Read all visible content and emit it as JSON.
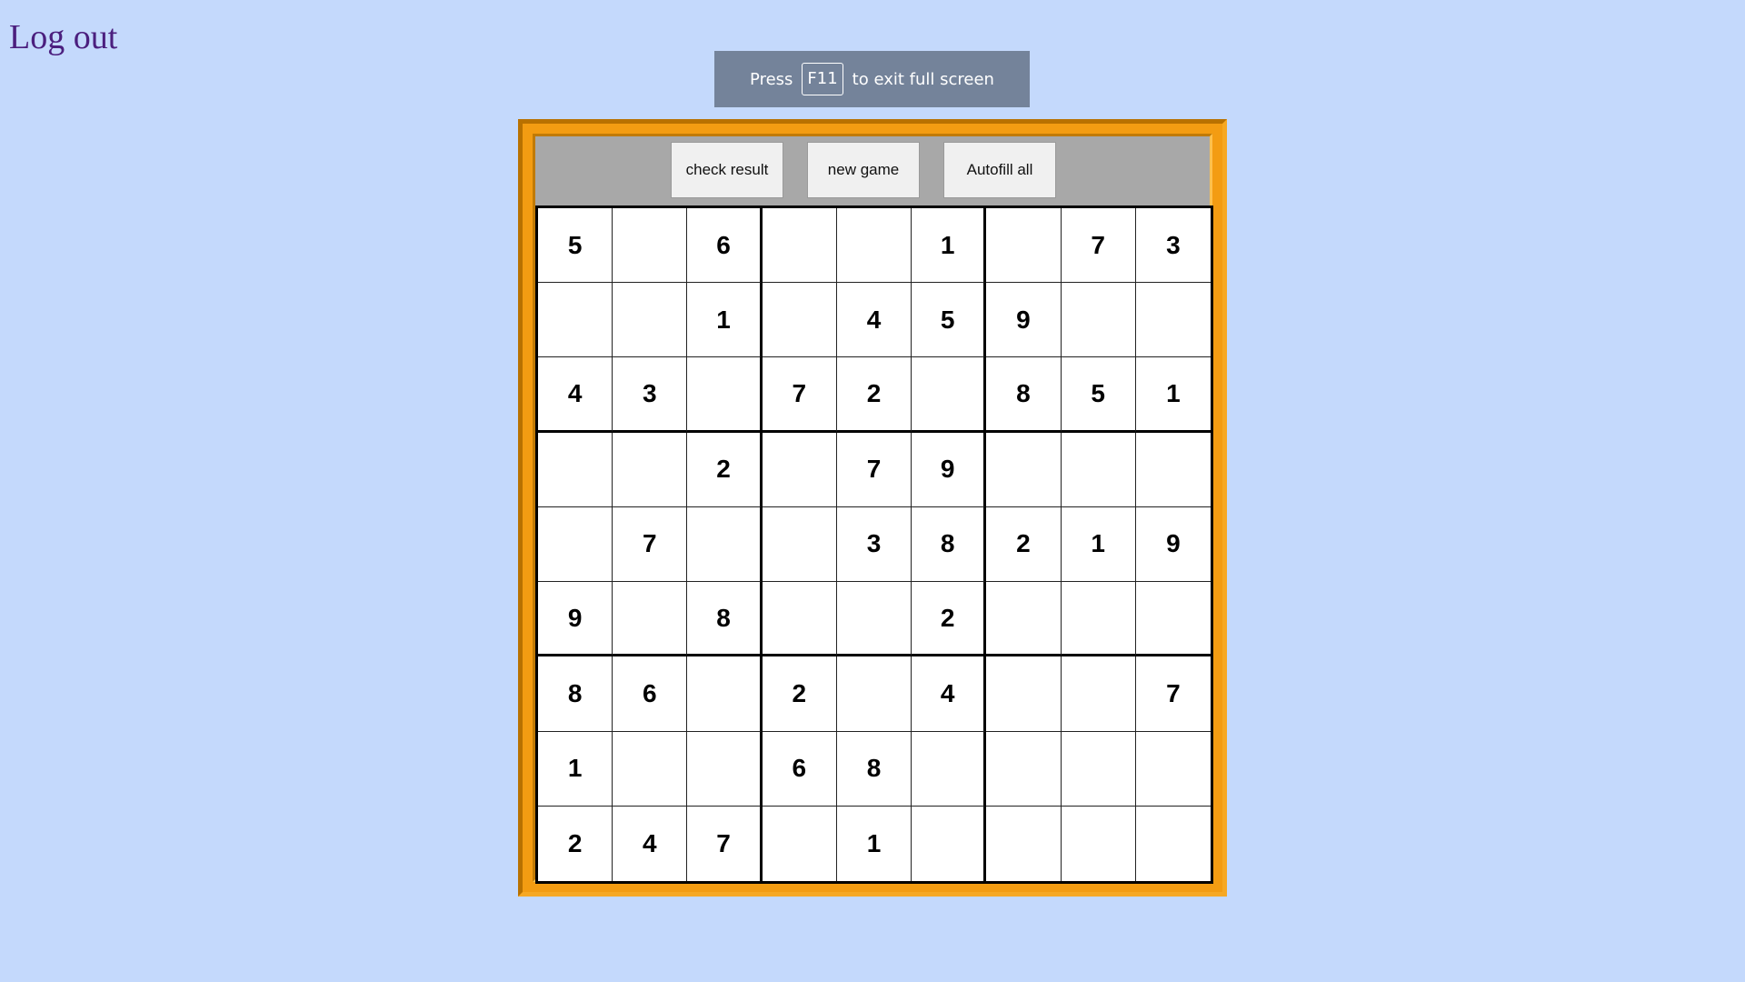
{
  "header": {
    "logout_label": "Log out"
  },
  "fullscreen_notice": {
    "before": "Press",
    "key": "F11",
    "after": "to exit full screen"
  },
  "toolbar": {
    "check_label": "check result",
    "new_game_label": "new game",
    "autofill_label": "Autofill all"
  },
  "colors": {
    "page_background": "#c4d9fc",
    "frame": "#f39c12",
    "toolbar": "#a8a8a8",
    "logout_link": "#4b1f7e"
  },
  "board": {
    "rows": [
      [
        "5",
        "",
        "6",
        "",
        "",
        "1",
        "",
        "7",
        "3"
      ],
      [
        "",
        "",
        "1",
        "",
        "4",
        "5",
        "9",
        "",
        ""
      ],
      [
        "4",
        "3",
        "",
        "7",
        "2",
        "",
        "8",
        "5",
        "1"
      ],
      [
        "",
        "",
        "2",
        "",
        "7",
        "9",
        "",
        "",
        ""
      ],
      [
        "",
        "7",
        "",
        "",
        "3",
        "8",
        "2",
        "1",
        "9"
      ],
      [
        "9",
        "",
        "8",
        "",
        "",
        "2",
        "",
        "",
        ""
      ],
      [
        "8",
        "6",
        "",
        "2",
        "",
        "4",
        "",
        "",
        "7"
      ],
      [
        "1",
        "",
        "",
        "6",
        "8",
        "",
        "",
        "",
        ""
      ],
      [
        "2",
        "4",
        "7",
        "",
        "1",
        "",
        "",
        "",
        ""
      ]
    ]
  }
}
